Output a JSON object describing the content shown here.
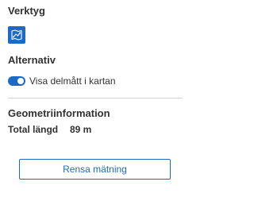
{
  "tools": {
    "title": "Verktyg",
    "measure_icon": "map-measure-icon"
  },
  "options": {
    "title": "Alternativ",
    "show_segment_toggle": {
      "label": "Visa delmått i kartan",
      "checked": true
    }
  },
  "geometry": {
    "title": "Geometriinformation",
    "total_length_label": "Total längd",
    "total_length_value": "89 m"
  },
  "actions": {
    "clear_label": "Rensa mätning"
  },
  "colors": {
    "accent": "#1b6bc6",
    "text": "#323232",
    "divider": "#d4d4d4"
  }
}
